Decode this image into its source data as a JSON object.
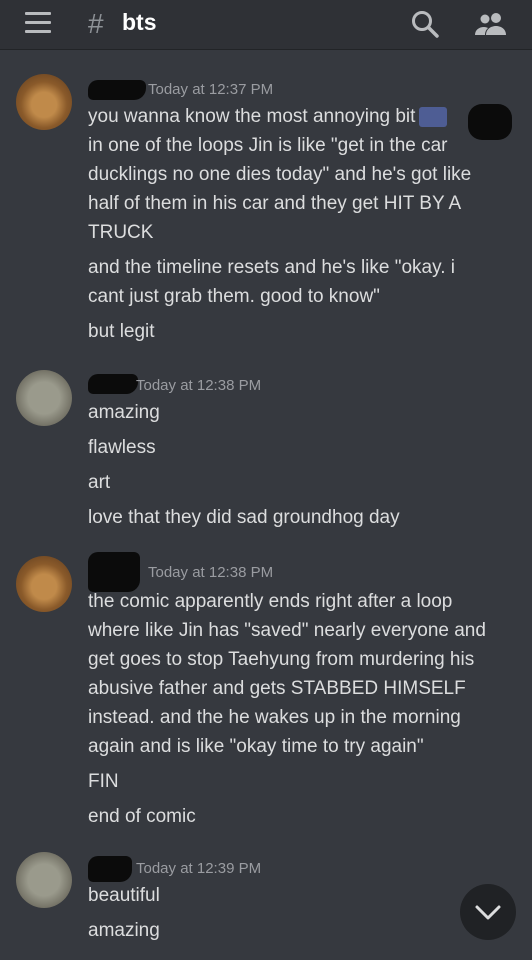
{
  "header": {
    "hash": "#",
    "channel": "bts",
    "icons": {
      "menu": "hamburger-icon",
      "search": "search-icon",
      "members": "members-icon"
    }
  },
  "messages": [
    {
      "timestamp": "Today at 12:37 PM",
      "avatar": "cat-avatar",
      "lines": [
        "you wanna know the most annoying bit",
        "in one of the loops Jin is like \"get in the car",
        "ducklings no one dies today\" and he's got like",
        "half of them in his car and they get HIT BY A",
        "TRUCK",
        "and the timeline resets and he's like \"okay. i",
        "cant just grab them. good to know\"",
        "but legit"
      ]
    },
    {
      "timestamp": "Today at 12:38 PM",
      "avatar": "bird-avatar",
      "lines": [
        "amazing",
        "flawless",
        "art",
        "love that they did sad groundhog day"
      ]
    },
    {
      "timestamp": "Today at 12:38 PM",
      "avatar": "cat-avatar",
      "lines": [
        "the comic apparently ends right after a loop",
        "where like Jin has \"saved\" nearly everyone and",
        "get goes to stop Taehyung from murdering his",
        "abusive father and gets STABBED HIMSELF",
        "instead. and the he wakes up in the morning",
        "again and is like \"okay time to try again\"",
        "FIN",
        "end of comic"
      ]
    },
    {
      "timestamp": "Today at 12:39 PM",
      "avatar": "bird-avatar",
      "lines": [
        "beautiful",
        "amazing"
      ]
    }
  ],
  "colors": {
    "background": "#36393f",
    "topbar": "#2f3136",
    "text": "#dcddde",
    "timestamp": "#9a9ca1",
    "mention": "#4e5d94"
  }
}
